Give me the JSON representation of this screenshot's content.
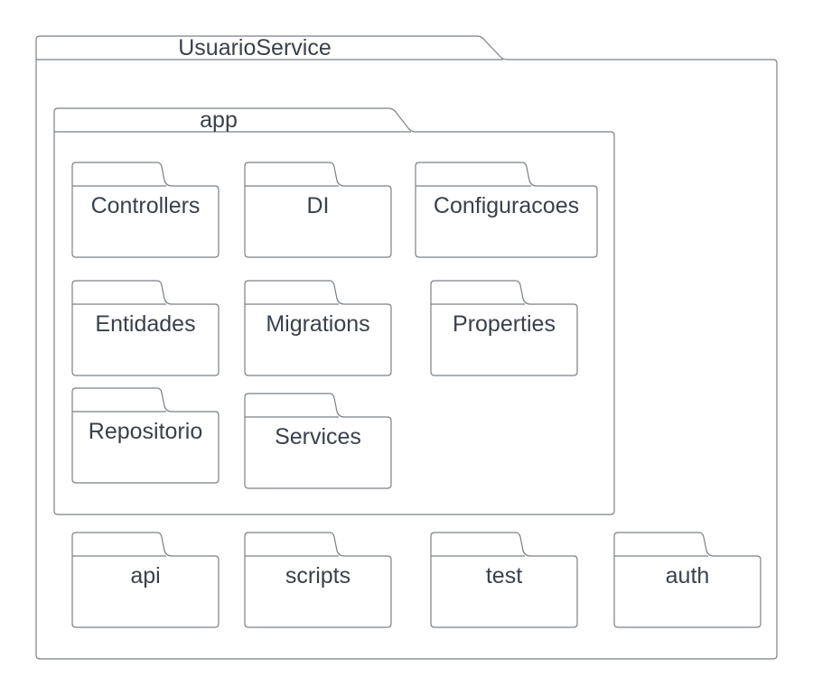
{
  "diagram": {
    "type": "UML package diagram",
    "colors": {
      "line": "#7b8087",
      "text": "#3a414b",
      "background": "#ffffff"
    },
    "root": {
      "name": "UsuarioService"
    },
    "app": {
      "name": "app",
      "packages": [
        {
          "name": "Controllers"
        },
        {
          "name": "DI"
        },
        {
          "name": "Configuracoes"
        },
        {
          "name": "Entidades"
        },
        {
          "name": "Migrations"
        },
        {
          "name": "Properties"
        },
        {
          "name": "Repositorio"
        },
        {
          "name": "Services"
        }
      ]
    },
    "bottom_packages": [
      {
        "name": "api"
      },
      {
        "name": "scripts"
      },
      {
        "name": "test"
      },
      {
        "name": "auth"
      }
    ]
  }
}
